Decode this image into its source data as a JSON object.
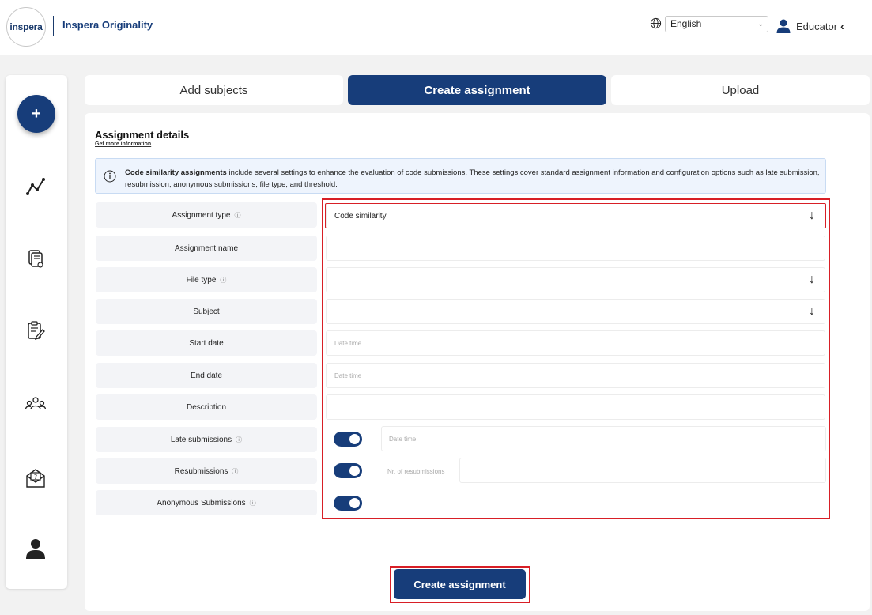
{
  "header": {
    "logo_text": "inspera",
    "app_name": "Inspera Originality",
    "language": "English",
    "user_role": "Educator",
    "user_chevron": "‹"
  },
  "sidebar": {
    "fab_label": "+",
    "items": [
      {
        "icon": "analytics-icon"
      },
      {
        "icon": "documents-icon"
      },
      {
        "icon": "assignment-edit-icon"
      },
      {
        "icon": "users-group-icon"
      },
      {
        "icon": "mail-help-icon"
      },
      {
        "icon": "profile-icon"
      }
    ]
  },
  "tabs": [
    {
      "label": "Add subjects",
      "active": false
    },
    {
      "label": "Create assignment",
      "active": true
    },
    {
      "label": "Upload",
      "active": false
    }
  ],
  "card": {
    "title": "Assignment details",
    "link": "Get more information",
    "info_bold": "Code similarity assignments",
    "info_text": " include several settings to enhance the evaluation of code submissions. These settings cover standard assignment information and configuration options such as late submission, resubmission, anonymous submissions, file type, and threshold."
  },
  "form": {
    "assignment_type_label": "Assignment type",
    "assignment_type_value": "Code similarity",
    "assignment_name_label": "Assignment name",
    "file_type_label": "File type",
    "subject_label": "Subject",
    "start_date_label": "Start date",
    "start_date_placeholder": "Date time",
    "end_date_label": "End date",
    "end_date_placeholder": "Date time",
    "description_label": "Description",
    "late_submissions_label": "Late submissions",
    "late_submissions_placeholder": "Date time",
    "resubmissions_label": "Resubmissions",
    "resubmissions_count_label": "Nr. of resubmissions",
    "anonymous_label": "Anonymous Submissions",
    "info_glyph": "ⓘ",
    "arrow_glyph": "↓"
  },
  "actions": {
    "create_label": "Create assignment"
  },
  "colors": {
    "primary": "#173d7a",
    "highlight": "#d81f26"
  }
}
